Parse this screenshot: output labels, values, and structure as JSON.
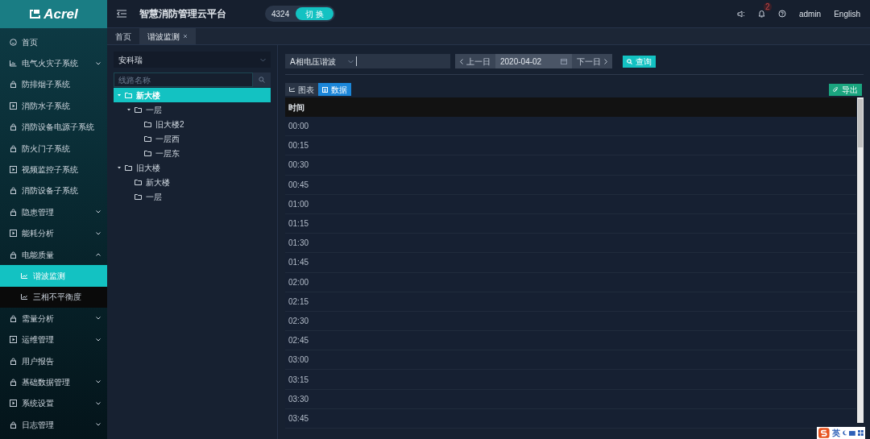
{
  "logo": {
    "text": "Acrel"
  },
  "header": {
    "title": "智慧消防管理云平台",
    "counter": "4324",
    "switch_button": "切 换",
    "notification_count": "2",
    "user": "admin",
    "language": "English"
  },
  "sidebar": {
    "items": [
      {
        "label": "首页",
        "expandable": false
      },
      {
        "label": "电气火灾子系统",
        "expandable": true,
        "expanded": false
      },
      {
        "label": "防排烟子系统",
        "expandable": false
      },
      {
        "label": "消防水子系统",
        "expandable": false
      },
      {
        "label": "消防设备电源子系统",
        "expandable": false
      },
      {
        "label": "防火门子系统",
        "expandable": false
      },
      {
        "label": "视频监控子系统",
        "expandable": false
      },
      {
        "label": "消防设备子系统",
        "expandable": false
      },
      {
        "label": "隐患管理",
        "expandable": true,
        "expanded": false
      },
      {
        "label": "能耗分析",
        "expandable": true,
        "expanded": false
      },
      {
        "label": "电能质量",
        "expandable": true,
        "expanded": true,
        "children": [
          {
            "label": "谐波监测",
            "selected": true
          },
          {
            "label": "三相不平衡度",
            "selected": false
          }
        ]
      },
      {
        "label": "需量分析",
        "expandable": true,
        "expanded": false
      },
      {
        "label": "运维管理",
        "expandable": true,
        "expanded": false
      },
      {
        "label": "用户报告",
        "expandable": false
      },
      {
        "label": "基础数据管理",
        "expandable": true,
        "expanded": false
      },
      {
        "label": "系统设置",
        "expandable": true,
        "expanded": false
      },
      {
        "label": "日志管理",
        "expandable": true,
        "expanded": false
      }
    ]
  },
  "tabs": [
    {
      "label": "首页",
      "selected": false,
      "closable": false
    },
    {
      "label": "谐波监测",
      "selected": true,
      "closable": true
    }
  ],
  "tree_panel": {
    "site_select": "安科瑞",
    "search_placeholder": "线路名称",
    "tree": [
      {
        "label": "新大楼",
        "selected": true,
        "expanded": true,
        "children": [
          {
            "label": "一层",
            "selected": false,
            "expanded": true,
            "children": [
              {
                "label": "旧大楼2",
                "selected": false
              },
              {
                "label": "一层西",
                "selected": false
              },
              {
                "label": "一层东",
                "selected": false
              }
            ]
          }
        ]
      },
      {
        "label": "旧大楼",
        "selected": false,
        "expanded": true,
        "children": [
          {
            "label": "新大楼",
            "selected": false
          },
          {
            "label": "一层",
            "selected": false
          }
        ]
      }
    ]
  },
  "toolbar": {
    "measure_select": "A相电压谐波",
    "prev_day": "上一日",
    "date": "2020-04-02",
    "next_day": "下一日",
    "query_button": "查询"
  },
  "view_tabs": [
    {
      "label": "图表",
      "selected": false
    },
    {
      "label": "数据",
      "selected": true
    }
  ],
  "export_button": "导出",
  "table": {
    "columns": [
      "时间"
    ],
    "rows": [
      [
        "00:00"
      ],
      [
        "00:15"
      ],
      [
        "00:30"
      ],
      [
        "00:45"
      ],
      [
        "01:00"
      ],
      [
        "01:15"
      ],
      [
        "01:30"
      ],
      [
        "01:45"
      ],
      [
        "02:00"
      ],
      [
        "02:15"
      ],
      [
        "02:30"
      ],
      [
        "02:45"
      ],
      [
        "03:00"
      ],
      [
        "03:15"
      ],
      [
        "03:30"
      ],
      [
        "03:45"
      ]
    ]
  },
  "ime_toolbar": {
    "mode": "英"
  }
}
